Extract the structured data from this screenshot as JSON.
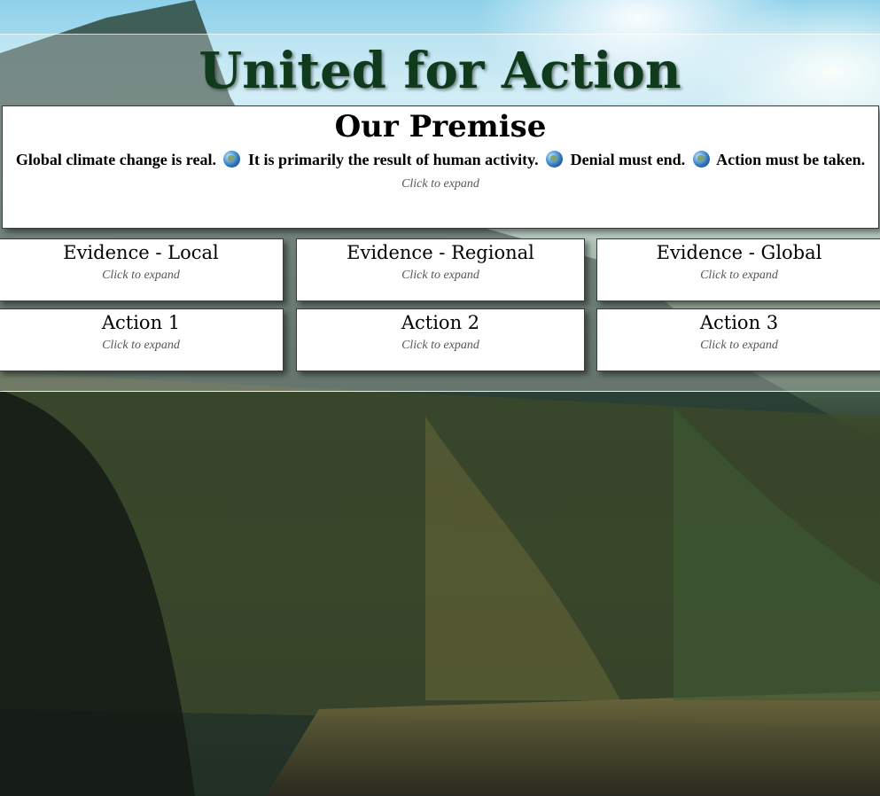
{
  "page": {
    "title": "United for Action"
  },
  "premise": {
    "heading": "Our Premise",
    "statements": [
      "Global climate change is real.",
      "It is primarily the result of human activity.",
      "Denial must end.",
      "Action must be taken."
    ],
    "separator_icon": "globe-icon",
    "hint": "Click to expand"
  },
  "evidence": [
    {
      "title": "Evidence - Local",
      "hint": "Click to expand"
    },
    {
      "title": "Evidence - Regional",
      "hint": "Click to expand"
    },
    {
      "title": "Evidence - Global",
      "hint": "Click to expand"
    }
  ],
  "actions": [
    {
      "title": "Action 1",
      "hint": "Click to expand"
    },
    {
      "title": "Action 2",
      "hint": "Click to expand"
    },
    {
      "title": "Action 3",
      "hint": "Click to expand"
    }
  ],
  "colors": {
    "title": "#0f3a1b",
    "card_bg": "#ffffff",
    "hint": "#555555"
  },
  "background": "forest-lake-mountain-photo"
}
